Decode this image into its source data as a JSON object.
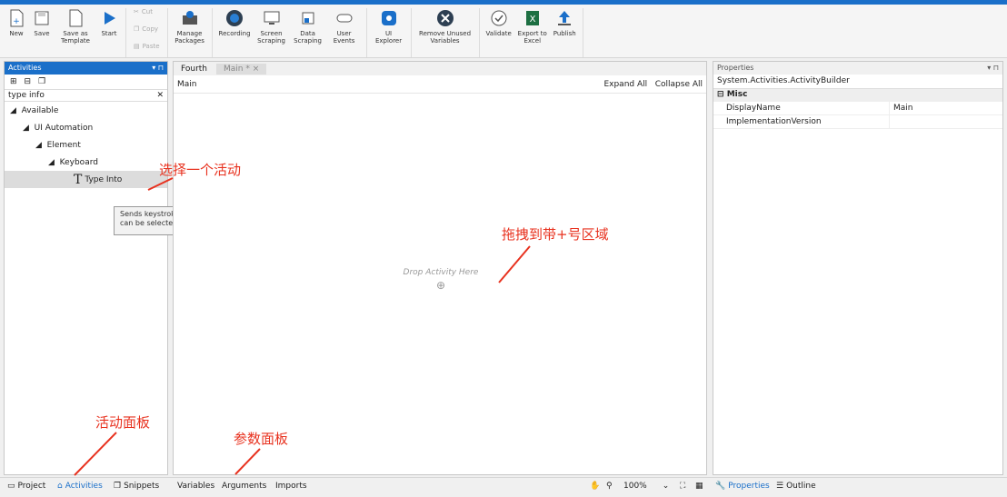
{
  "ribbon": {
    "new": "New",
    "save": "Save",
    "save_as_template": "Save as Template",
    "start": "Start",
    "cut": "Cut",
    "copy": "Copy",
    "paste": "Paste",
    "manage_packages": "Manage Packages",
    "recording": "Recording",
    "screen_scraping": "Screen Scraping",
    "data_scraping": "Data Scraping",
    "user_events": "User Events",
    "ui_explorer": "UI Explorer",
    "remove_unused": "Remove Unused Variables",
    "validate": "Validate",
    "export_excel": "Export to Excel",
    "publish": "Publish"
  },
  "activities_panel": {
    "title": "Activities",
    "search_value": "type  info",
    "tree": [
      "Available",
      "UI Automation",
      "Element",
      "Keyboard",
      "Type Into"
    ],
    "tooltip": "Sends keystrokes to a UI element. Special keys are supported and can be selected from the drop-down list."
  },
  "designer": {
    "tabs": [
      "Fourth",
      "Main * ×"
    ],
    "breadcrumb": "Main",
    "expand_all": "Expand All",
    "collapse_all": "Collapse All",
    "drop_text": "Drop Activity Here"
  },
  "properties": {
    "title": "Properties",
    "type_name": "System.Activities.ActivityBuilder",
    "section": "Misc",
    "rows": [
      {
        "name": "DisplayName",
        "value": "Main"
      },
      {
        "name": "ImplementationVersion",
        "value": ""
      }
    ]
  },
  "bottom": {
    "project": "Project",
    "activities": "Activities",
    "snippets": "Snippets",
    "variables": "Variables",
    "arguments": "Arguments",
    "imports": "Imports",
    "zoom": "100%",
    "properties": "Properties",
    "outline": "Outline"
  },
  "annotations": {
    "select_activity": "选择一个活动",
    "drag_to": "拖拽到带+号区域",
    "activities_panel": "活动面板",
    "arguments_panel": "参数面板"
  }
}
